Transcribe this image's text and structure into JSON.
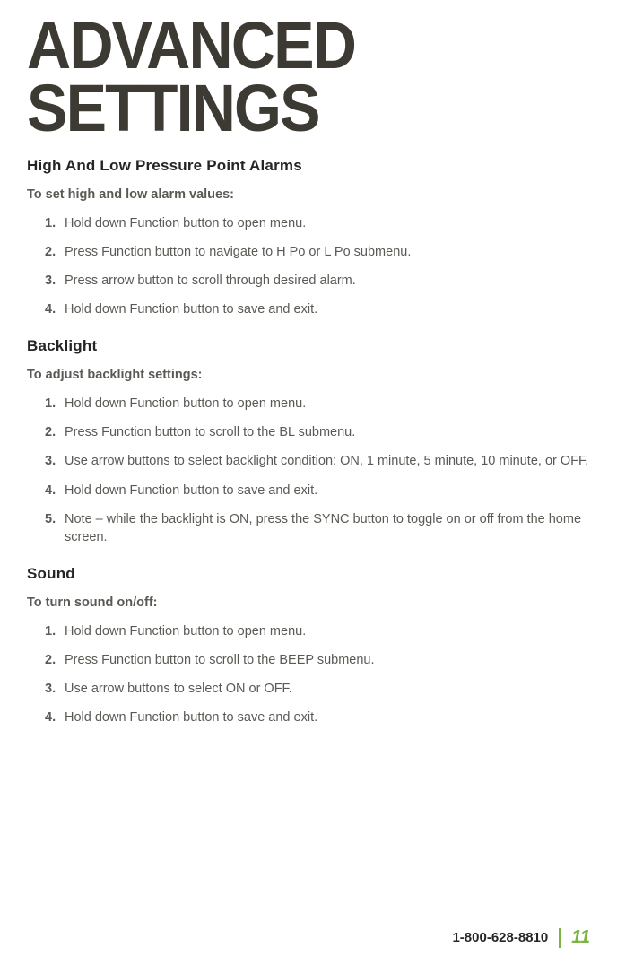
{
  "title_line1": "ADVANCED",
  "title_line2": "SETTINGS",
  "sections": [
    {
      "heading": "High And Low Pressure Point Alarms",
      "sub_heading": "To set high and low alarm values:",
      "steps": [
        "Hold down Function button to open menu.",
        "Press Function button to navigate to H Po or L Po submenu.",
        "Press arrow button to scroll through desired alarm.",
        "Hold down Function button to save and exit."
      ]
    },
    {
      "heading": "Backlight",
      "sub_heading": "To adjust backlight settings:",
      "steps": [
        "Hold down Function button to open menu.",
        "Press Function button to scroll to the BL submenu.",
        "Use arrow buttons to select backlight condition:  ON, 1 minute, 5 minute, 10 minute,  or OFF.",
        "Hold down Function button to save and exit.",
        "Note – while the backlight is ON, press the SYNC button to toggle on or off from the home screen."
      ]
    },
    {
      "heading": "Sound",
      "sub_heading": "To turn sound on/off:",
      "steps": [
        "Hold down Function button to open menu.",
        "Press Function button to scroll to the BEEP submenu.",
        "Use arrow buttons to select ON or OFF.",
        "Hold down Function button to save and exit."
      ]
    }
  ],
  "footer": {
    "phone": "1-800-628-8810",
    "page_number": "11"
  }
}
